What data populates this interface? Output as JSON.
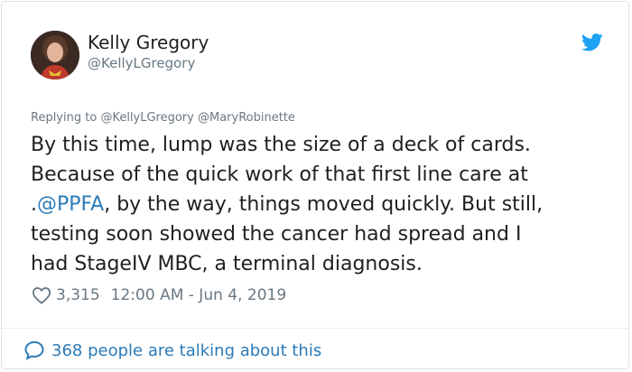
{
  "author": {
    "name": "Kelly Gregory",
    "handle": "@KellyLGregory"
  },
  "reply": {
    "prefix": "Replying to ",
    "to_1": "@KellyLGregory",
    "to_2": "@MaryRobinette"
  },
  "tweet": {
    "line_1": "By this time, lump was the size of a deck of cards.",
    "line_2": "Because of the quick work of that first line care at",
    "line_3_prefix": ".",
    "line_3_mention": "@PPFA",
    "line_3_suffix": ", by the way, things moved quickly. But still,",
    "line_4": "testing soon showed the cancer had spread and I",
    "line_5": "had StageIV MBC, a terminal diagnosis."
  },
  "meta": {
    "likes": "3,315",
    "timestamp": "12:00 AM - Jun 4, 2019"
  },
  "footer": {
    "talking": "368 people are talking about this"
  },
  "colors": {
    "link_blue": "#2b7bb9",
    "twitter_blue": "#1da1f2",
    "text": "#1c2022",
    "secondary": "#697882"
  },
  "icons": [
    "twitter-bird-icon",
    "heart-icon",
    "comment-bubble-icon"
  ]
}
